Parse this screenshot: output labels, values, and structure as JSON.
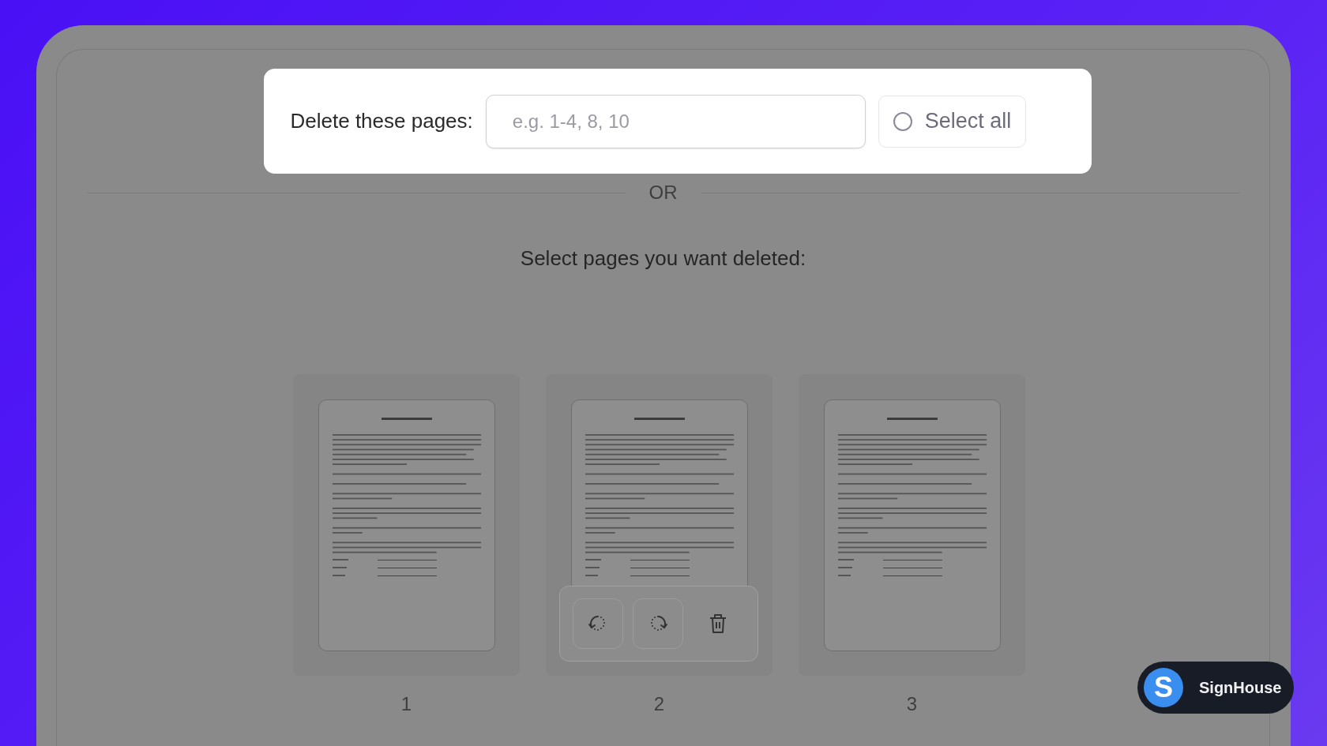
{
  "delete_form": {
    "label": "Delete these pages:",
    "input": {
      "placeholder": "e.g. 1-4, 8, 10"
    },
    "select_all": {
      "label": "Select all",
      "checked": false
    }
  },
  "divider_text": "OR",
  "instruction": "Select pages you want deleted:",
  "pages": [
    {
      "number": "1",
      "hovered": false
    },
    {
      "number": "2",
      "hovered": true
    },
    {
      "number": "3",
      "hovered": false
    }
  ],
  "badge": {
    "logo_letter": "S",
    "name": "SignHouse"
  }
}
